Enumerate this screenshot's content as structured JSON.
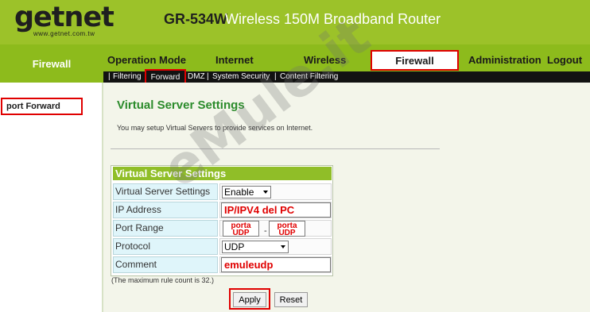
{
  "header": {
    "logo": "getnet",
    "logo_url": "www.getnet.com.tw",
    "model": "GR-534W",
    "product": "Wireless 150M Broadband Router"
  },
  "nav": {
    "section_title": "Firewall",
    "items": [
      "Operation Mode",
      "Internet",
      "Wireless",
      "Firewall",
      "Administration",
      "Logout"
    ],
    "active": "Firewall"
  },
  "subnav": {
    "items": [
      "Filtering",
      "Forward",
      "DMZ",
      "System Security",
      "Content Filtering"
    ],
    "active": "Forward"
  },
  "sidebar": {
    "items": [
      "port Forward"
    ]
  },
  "page": {
    "title": "Virtual Server Settings",
    "description": "You may setup Virtual Servers to provide services on Internet."
  },
  "form": {
    "header": "Virtual Server Settings",
    "rows": {
      "enable": {
        "label": "Virtual Server Settings",
        "value": "Enable"
      },
      "ip": {
        "label": "IP Address",
        "value": "IP/IPV4 del PC"
      },
      "port": {
        "label": "Port Range",
        "from": "porta UDP",
        "to": "porta UDP"
      },
      "protocol": {
        "label": "Protocol",
        "value": "UDP"
      },
      "comment": {
        "label": "Comment",
        "value": "emuleudp"
      }
    },
    "max_note": "(The maximum rule count is 32.)",
    "apply_label": "Apply",
    "reset_label": "Reset"
  },
  "watermark": "eMule.it",
  "colors": {
    "header": "#9cc229",
    "nav": "#8dbb1c",
    "subnav": "#121212",
    "title_green": "#2b8b2b",
    "highlight_red": "#e00000",
    "label_cell": "#dff5fa"
  }
}
